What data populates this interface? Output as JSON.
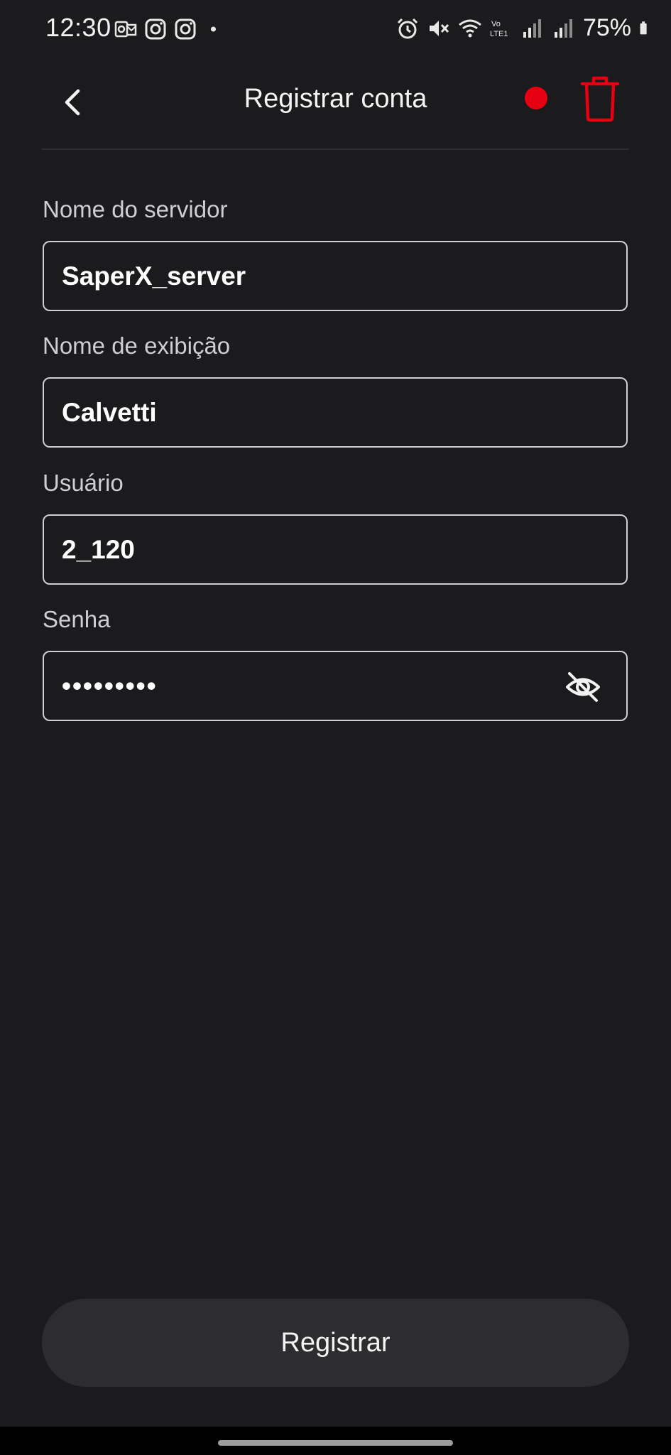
{
  "status_bar": {
    "time": "12:30",
    "battery": "75%",
    "left_icons": [
      "outlook-icon",
      "instagram-icon",
      "instagram-icon",
      "notification-dot-icon"
    ],
    "right_icons": [
      "alarm-icon",
      "mute-icon",
      "wifi-icon",
      "volte-icon",
      "signal-icon",
      "signal-icon",
      "battery-icon"
    ]
  },
  "header": {
    "title": "Registrar conta",
    "back_icon": "chevron-left-icon",
    "status_dot_color": "#e60012",
    "delete_icon": "trash-icon",
    "delete_color": "#e60012"
  },
  "form": {
    "server_name": {
      "label": "Nome do servidor",
      "value": "SaperX_server"
    },
    "display_name": {
      "label": "Nome de exibição",
      "value": "Calvetti"
    },
    "username": {
      "label": "Usuário",
      "value": "2_120"
    },
    "password": {
      "label": "Senha",
      "value": "•••••••••",
      "toggle_icon": "eye-off-icon"
    }
  },
  "actions": {
    "register_label": "Registrar"
  },
  "colors": {
    "background": "#1b1b1d",
    "accent": "#e60012",
    "button": "#2d2d30"
  }
}
